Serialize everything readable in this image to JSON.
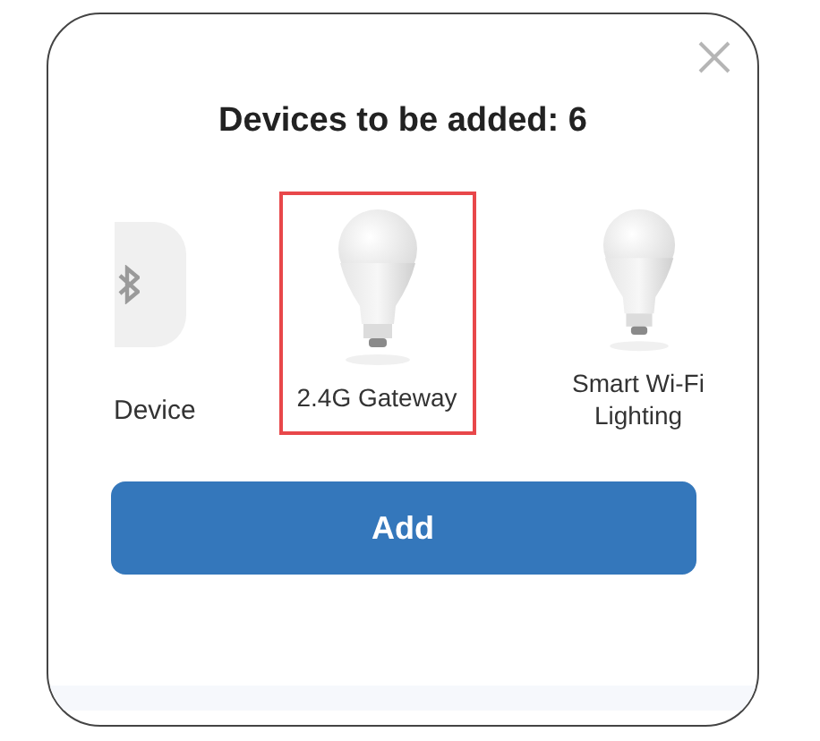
{
  "dialog": {
    "title": "Devices to be added: 6"
  },
  "devices": [
    {
      "kind": "bluetooth",
      "label": "Device",
      "selected": false
    },
    {
      "kind": "bulb",
      "label": "2.4G Gateway",
      "selected": true
    },
    {
      "kind": "bulb",
      "label": "Smart Wi-Fi Lighting",
      "selected": false
    }
  ],
  "button": "Add"
}
